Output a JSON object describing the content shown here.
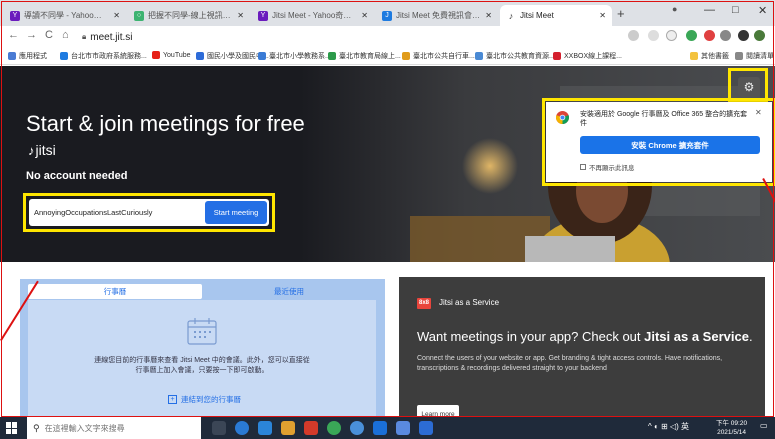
{
  "browser": {
    "tabs": [
      {
        "label": "導讀不同學 - Yahoo奇摩 搜尋結果",
        "fav_color": "#6a1bbd",
        "fav_letter": "Y"
      },
      {
        "label": "把握不同學-線上視訊研討站",
        "fav_color": "#3cb371",
        "fav_letter": "○"
      },
      {
        "label": "Jitsi Meet - Yahoo奇摩 搜尋結果",
        "fav_color": "#6a1bbd",
        "fav_letter": "Y"
      },
      {
        "label": "Jitsi Meet 免費視訊會議軟體 - 免費開",
        "fav_color": "#1e7be0",
        "fav_letter": "J"
      },
      {
        "label": "Jitsi Meet",
        "fav_color": "#ffffff",
        "fav_letter": "♪"
      }
    ],
    "new_tab": "+",
    "window_controls": {
      "account": "●",
      "minimize": "—",
      "maximize": "□",
      "close": "✕"
    },
    "nav": {
      "back": "←",
      "forward": "→",
      "reload": "C",
      "home": "⌂"
    },
    "url": "meet.jit.si",
    "bookmarks": [
      {
        "label": "應用程式",
        "color": "#4a7bd4"
      },
      {
        "label": "台北市市政府系統服務...",
        "color": "#1e7be0"
      },
      {
        "label": "YouTube",
        "color": "#e62117"
      },
      {
        "label": "國民小學及國民中...",
        "color": "#2d6bd8"
      },
      {
        "label": "臺北市小學教務系...",
        "color": "#3a7bd5"
      },
      {
        "label": "臺北市教育局線上...",
        "color": "#2c9a4a"
      },
      {
        "label": "臺北市公共自行車...",
        "color": "#e09b1a"
      },
      {
        "label": "臺北市公共教育資源...",
        "color": "#4a8ad4"
      },
      {
        "label": "XXBOX線上課程...",
        "color": "#d4202e"
      },
      {
        "label": "其他書籤",
        "color": "#f3c23d"
      },
      {
        "label": "閱讀清單",
        "color": "#888888"
      }
    ]
  },
  "hero": {
    "logo": "jitsi",
    "logo_glyph": "♪",
    "headline": "Start & join meetings for free",
    "subhead": "No account needed",
    "room_name": "AnnoyingOccupationsLastCuriously",
    "start_button": "Start meeting",
    "settings_icon": "⚙"
  },
  "chrome_popup": {
    "text": "安裝適用於 Google 行事曆及 Office 365 整合的擴充套件",
    "install_button": "安裝 Chrome 擴充套件",
    "dont_show": "不再顯示此訊息",
    "close": "✕"
  },
  "calendar": {
    "tab_calendar": "行事曆",
    "tab_recent": "最近使用",
    "text": "連線您目前的行事曆來查看 Jitsi Meet 中的會議。此外，您可以直接從行事曆上加入會議，只要按一下即可啟動。",
    "connect_button": "連結到您的行事曆"
  },
  "jaas": {
    "logo": "8x8",
    "title": "Jitsi as a Service",
    "headline_prefix": "Want meetings in your app? Check out ",
    "headline_strong": "Jitsi as a Service",
    "headline_suffix": ".",
    "desc": "Connect the users of your website or app. Get branding & tight access controls. Have notifications, transcriptions & recordings delivered straight to your backend",
    "learn_more": "Learn more"
  },
  "taskbar": {
    "search_placeholder": "在這裡輸入文字來搜尋",
    "tray": "^ ◐ ⊞ ◁) 英",
    "time": "下午 09:20",
    "date": "2021/5/14"
  }
}
